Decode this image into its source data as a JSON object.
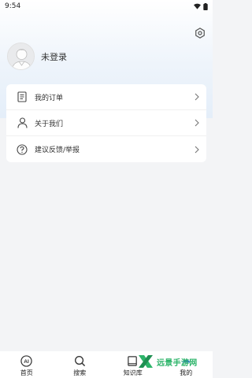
{
  "status_bar": {
    "time": "9:54"
  },
  "profile": {
    "name": "未登录"
  },
  "menu": [
    {
      "label": "我的订单",
      "icon": "document-icon"
    },
    {
      "label": "关于我们",
      "icon": "person-icon"
    },
    {
      "label": "建议反馈/举报",
      "icon": "help-icon"
    }
  ],
  "tabs": [
    {
      "label": "首页",
      "icon": "ai-icon"
    },
    {
      "label": "搜索",
      "icon": "search-icon"
    },
    {
      "label": "知识库",
      "icon": "book-icon"
    },
    {
      "label": "我的",
      "icon": "user-icon",
      "active": true
    }
  ],
  "watermark": {
    "text": "远景手游网"
  },
  "colors": {
    "accent": "#2d6bd8",
    "watermark": "#2db46a",
    "background": "#f3f4f6"
  }
}
